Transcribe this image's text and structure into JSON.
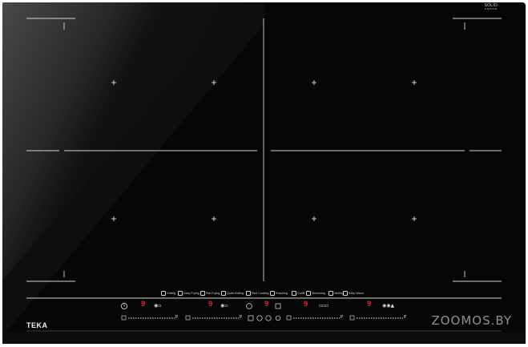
{
  "product": {
    "brand_logo": "TEKA",
    "top_right_mark_line1": "SOLID",
    "top_right_mark_line2": "CERAM"
  },
  "functions": [
    {
      "label": "Grilling"
    },
    {
      "label": "Deep Frying"
    },
    {
      "label": "Pan Frying"
    },
    {
      "label": "Quick Boiling"
    },
    {
      "label": "Rice Cooking"
    },
    {
      "label": "Poaching"
    },
    {
      "label": "Confit"
    },
    {
      "label": "Simmering"
    },
    {
      "label": "Melting"
    },
    {
      "label": "Keep Warm"
    }
  ],
  "zones": [
    {
      "power_level": "9"
    },
    {
      "power_level": "9"
    },
    {
      "power_level": "9"
    },
    {
      "power_level": "9"
    },
    {
      "power_level": "9"
    }
  ],
  "slider_label": "P",
  "watermark": "ZOOMOS.BY",
  "colors": {
    "glass": "#050505",
    "line": "#cfcfcf",
    "display_digit": "#e0252a"
  }
}
